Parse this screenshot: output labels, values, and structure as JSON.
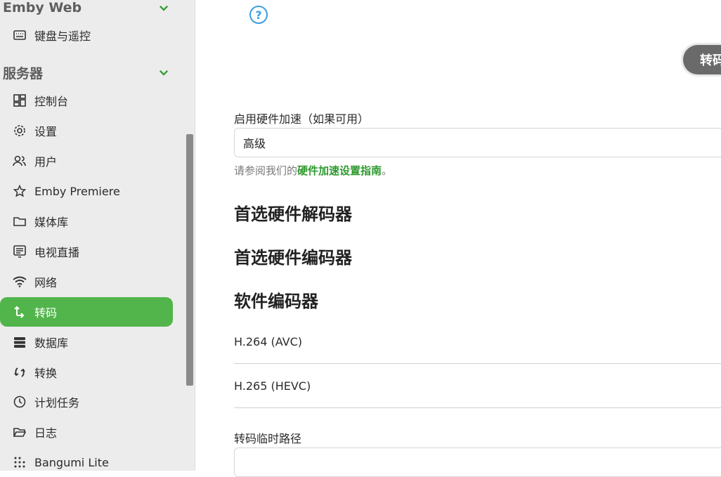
{
  "sidebar": {
    "sections": [
      {
        "title": "Emby Web",
        "items": [
          {
            "label": "键盘与遥控",
            "icon": "keyboard-icon"
          }
        ]
      },
      {
        "title": "服务器",
        "items": [
          {
            "label": "控制台",
            "icon": "dashboard-icon"
          },
          {
            "label": "设置",
            "icon": "gear-icon"
          },
          {
            "label": "用户",
            "icon": "users-icon"
          },
          {
            "label": "Emby Premiere",
            "icon": "star-icon"
          },
          {
            "label": "媒体库",
            "icon": "folder-icon"
          },
          {
            "label": "电视直播",
            "icon": "tv-guide-icon"
          },
          {
            "label": "网络",
            "icon": "wifi-icon"
          },
          {
            "label": "转码",
            "icon": "transcode-icon",
            "active": true
          },
          {
            "label": "数据库",
            "icon": "database-icon"
          },
          {
            "label": "转换",
            "icon": "convert-icon"
          },
          {
            "label": "计划任务",
            "icon": "clock-icon"
          },
          {
            "label": "日志",
            "icon": "folder-open-icon"
          },
          {
            "label": "Bangumi Lite",
            "icon": "dots-grid-icon"
          }
        ]
      }
    ],
    "accent_color": "#52b54b"
  },
  "main": {
    "help_icon": "?",
    "pill_button_label": "转码",
    "hw_accel": {
      "label": "启用硬件加速（如果可用）",
      "value": "高级",
      "helper_prefix": "请参阅我们的",
      "helper_link": "硬件加速设置指南",
      "helper_suffix": "。"
    },
    "preferred_decoders_heading": "首选硬件解码器",
    "preferred_encoders_heading": "首选硬件编码器",
    "software_encoders_heading": "软件编码器",
    "software_encoders": [
      "H.264 (AVC)",
      "H.265 (HEVC)"
    ],
    "temp_path_label": "转码临时路径"
  }
}
